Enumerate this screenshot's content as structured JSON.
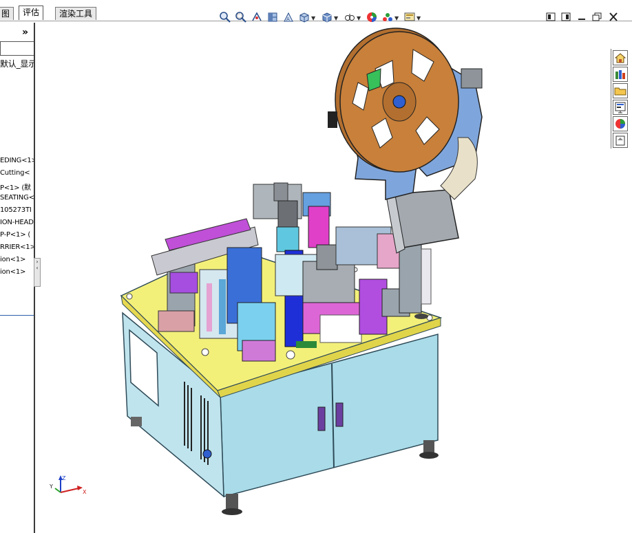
{
  "tabs": [
    {
      "label": "图",
      "active": false
    },
    {
      "label": "评估",
      "active": true
    },
    {
      "label": "渲染工具",
      "active": false
    }
  ],
  "hud_icons": [
    "zoom-to-fit-icon",
    "zoom-area-icon",
    "previous-view-icon",
    "section-view-icon",
    "dynamic-annotation-icon",
    "view-orientation-icon",
    "display-style-icon",
    "hide-show-items-icon",
    "edit-appearance-icon",
    "apply-scene-icon",
    "view-settings-icon"
  ],
  "window_icons": [
    "tile-horizontal-icon",
    "tile-vertical-icon",
    "minimize-icon",
    "restore-icon",
    "close-icon"
  ],
  "panel": {
    "collapse_label": "»",
    "filter_value": "",
    "config_text": "默认_显示",
    "tree_items": [
      "EDING<1>",
      "Cutting<",
      "P<1> (默",
      "SEATING<",
      "105273TI",
      "ION-HEAD",
      "P-P<1> (",
      "RRIER<1>",
      "ion<1>",
      "ion<1>"
    ]
  },
  "splitter": {
    "arrows": [
      "›",
      "‹"
    ]
  },
  "taskpane_icons": [
    "home-icon",
    "design-library-icon",
    "file-explorer-icon",
    "view-palette-icon",
    "appearances-icon",
    "custom-properties-icon"
  ],
  "triad": {
    "z": "Z",
    "y": "Y",
    "x": "X"
  },
  "colors": {
    "accent": "#2a5ea8",
    "table_top": "#f3f07a",
    "cabinet": "#a9dbe8",
    "reel": "#c8803a",
    "reel_plate": "#7fa6dc"
  }
}
